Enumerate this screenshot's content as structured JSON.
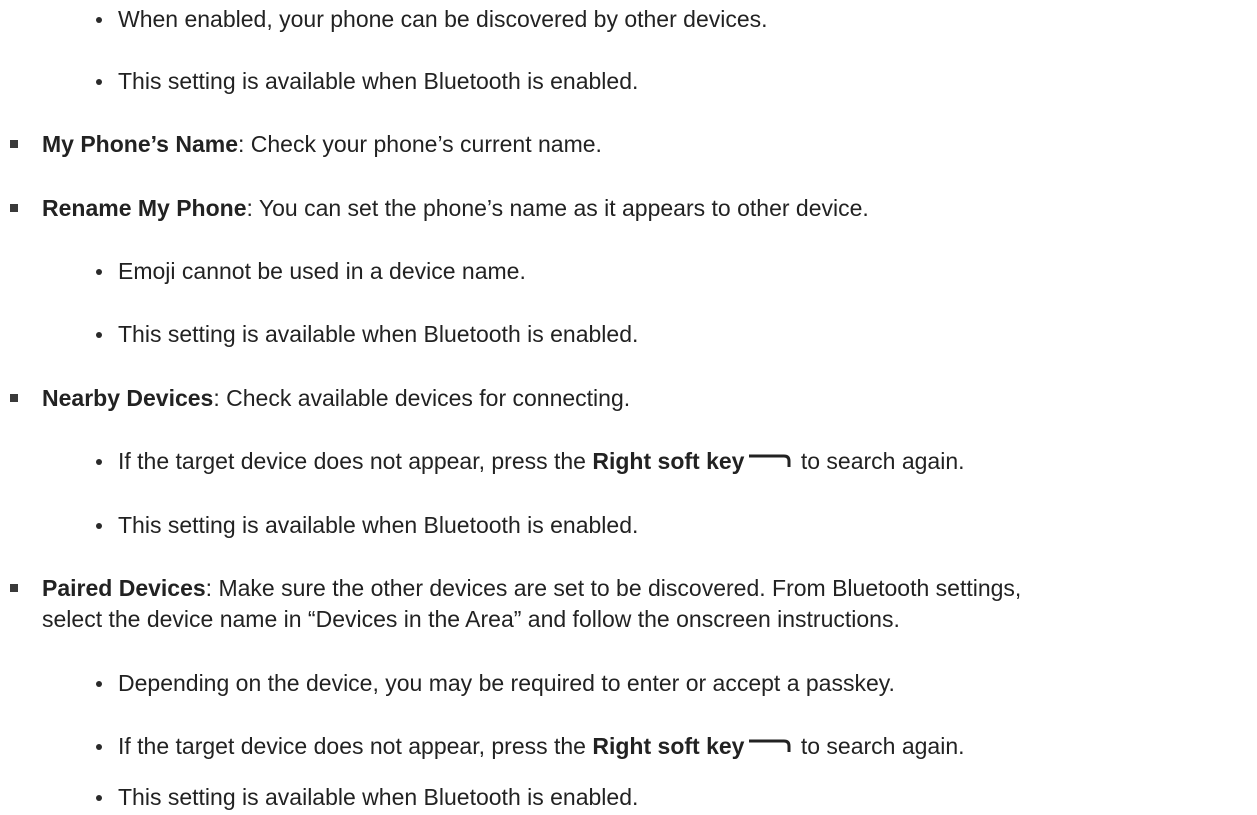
{
  "items": {
    "discoverable_sub1": "When enabled, your phone can be discovered by other devices.",
    "discoverable_sub2": "This setting is available when Bluetooth is enabled.",
    "my_phone_name": {
      "label": "My Phone’s Name",
      "text": ": Check your phone’s current name."
    },
    "rename_my_phone": {
      "label": "Rename My Phone",
      "text": ": You can set the phone’s name as it appears to other device.",
      "sub1": "Emoji cannot be used in a device name.",
      "sub2": "This setting is available when Bluetooth is enabled."
    },
    "nearby_devices": {
      "label": "Nearby Devices",
      "text": ": Check available devices for connecting.",
      "sub1_pre": "If the target device does not appear, press the ",
      "sub1_key": "Right soft key",
      "sub1_post": " to search again.",
      "sub2": "This setting is available when Bluetooth is enabled."
    },
    "paired_devices": {
      "label": "Paired Devices",
      "text": ": Make sure the other devices are set to be discovered. From Bluetooth settings,",
      "text_cont": "select the device name in “Devices in the Area” and follow the onscreen instructions.",
      "sub1": "Depending on the device, you may be required to enter or accept a passkey.",
      "sub2_pre": "If the target device does not appear, press the ",
      "sub2_key": "Right soft key",
      "sub2_post": " to search again.",
      "sub3": "This setting is available when Bluetooth is enabled."
    }
  },
  "icons": {
    "softkey": "right-soft-key-icon"
  }
}
